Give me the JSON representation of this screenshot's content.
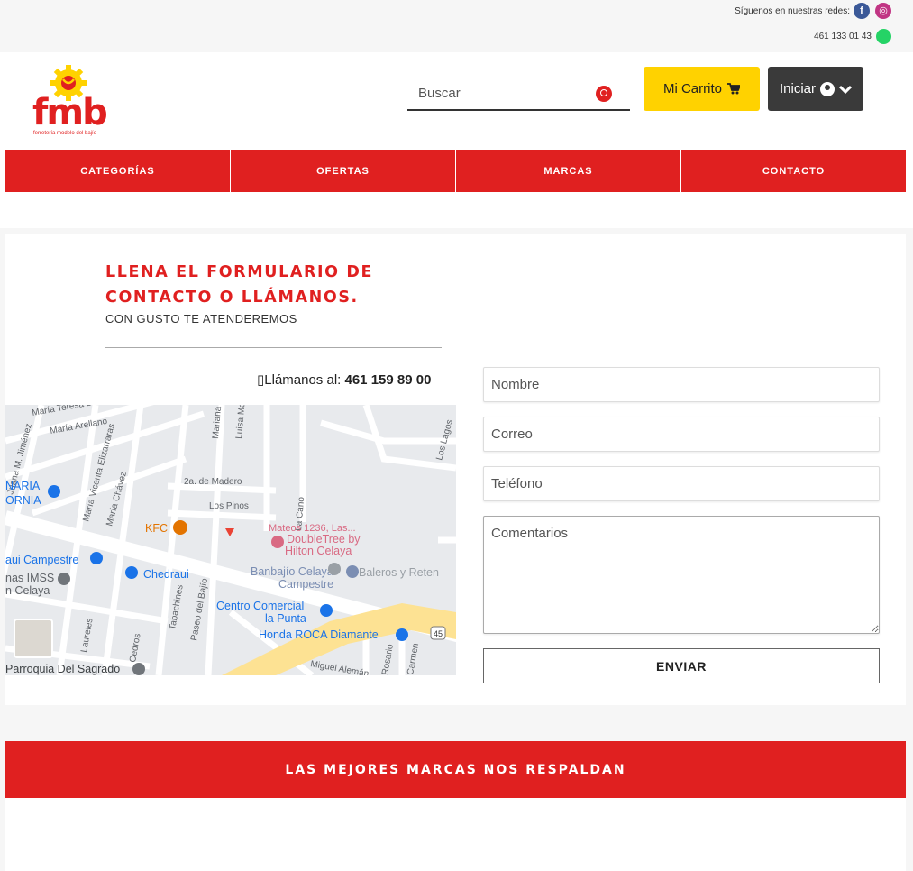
{
  "topbar": {
    "social_text": "Síguenos en nuestras redes:",
    "phone": "461 133 01 43"
  },
  "header": {
    "logo_text": "fmb",
    "logo_subtext": "ferretería modelo del bajío",
    "search_placeholder": "Buscar",
    "cart_label": "Mi Carrito",
    "login_label": "Iniciar"
  },
  "nav": {
    "items": [
      {
        "label": "CATEGORÍAS"
      },
      {
        "label": "OFERTAS"
      },
      {
        "label": "MARCAS"
      },
      {
        "label": "CONTACTO"
      }
    ]
  },
  "contact": {
    "title": "LLENA EL FORMULARIO DE CONTACTO O LLÁMANOS.",
    "subtitle": "CON GUSTO TE ATENDEREMOS",
    "call_label": "Llámanos al:",
    "call_number": "461 159 89 00",
    "form": {
      "name_placeholder": "Nombre",
      "email_placeholder": "Correo",
      "phone_placeholder": "Teléfono",
      "comments_placeholder": "Comentarios",
      "submit_label": "ENVIAR"
    }
  },
  "map": {
    "labels": {
      "teresa": "María Teresa Bara",
      "arellano": "María Arellano",
      "jimenez": "Juana M. Jiménez",
      "naria": "NARIA",
      "ornia": "ORNIA",
      "elizarraras": "María Vicenta Elizarraras",
      "chavez": "María Chávez",
      "mariana": "Mariana",
      "luisa": "Luisa Ma",
      "madero": "2a. de Madero",
      "pinos": "Los Pinos",
      "cano": "La Cano",
      "lagos": "Los Lagos",
      "kfc": "KFC",
      "mateos": "Mateos 1236, Las...",
      "doubletree": "DoubleTree by",
      "hilton": "Hilton Celaya",
      "campestre_ui": "aui Campestre",
      "chedraui": "Chedraui",
      "imss": "nas IMSS",
      "celaya_n": "n Celaya",
      "banbajio": "Banbajío Celaya",
      "baleros": "Baleros y Reten",
      "campestre": "Campestre",
      "tabachines": "Tabachines",
      "paseo": "Paseo del Bajío",
      "centro1": "Centro Comercial",
      "centro2": "la Punta",
      "honda": "Honda ROCA Diamante",
      "laureles": "Laureles",
      "cedros": "Cedros",
      "parroquia": "Parroquia Del Sagrado",
      "aleman": "Miguel Alemán",
      "rosario": "Rosario",
      "carmen": "Carmen",
      "route": "45"
    }
  },
  "brands_banner": "LAS MEJORES MARCAS NOS RESPALDAN",
  "colors": {
    "brand_red": "#e02020",
    "cart_yellow": "#ffd200",
    "login_dark": "#3a3a3a"
  }
}
